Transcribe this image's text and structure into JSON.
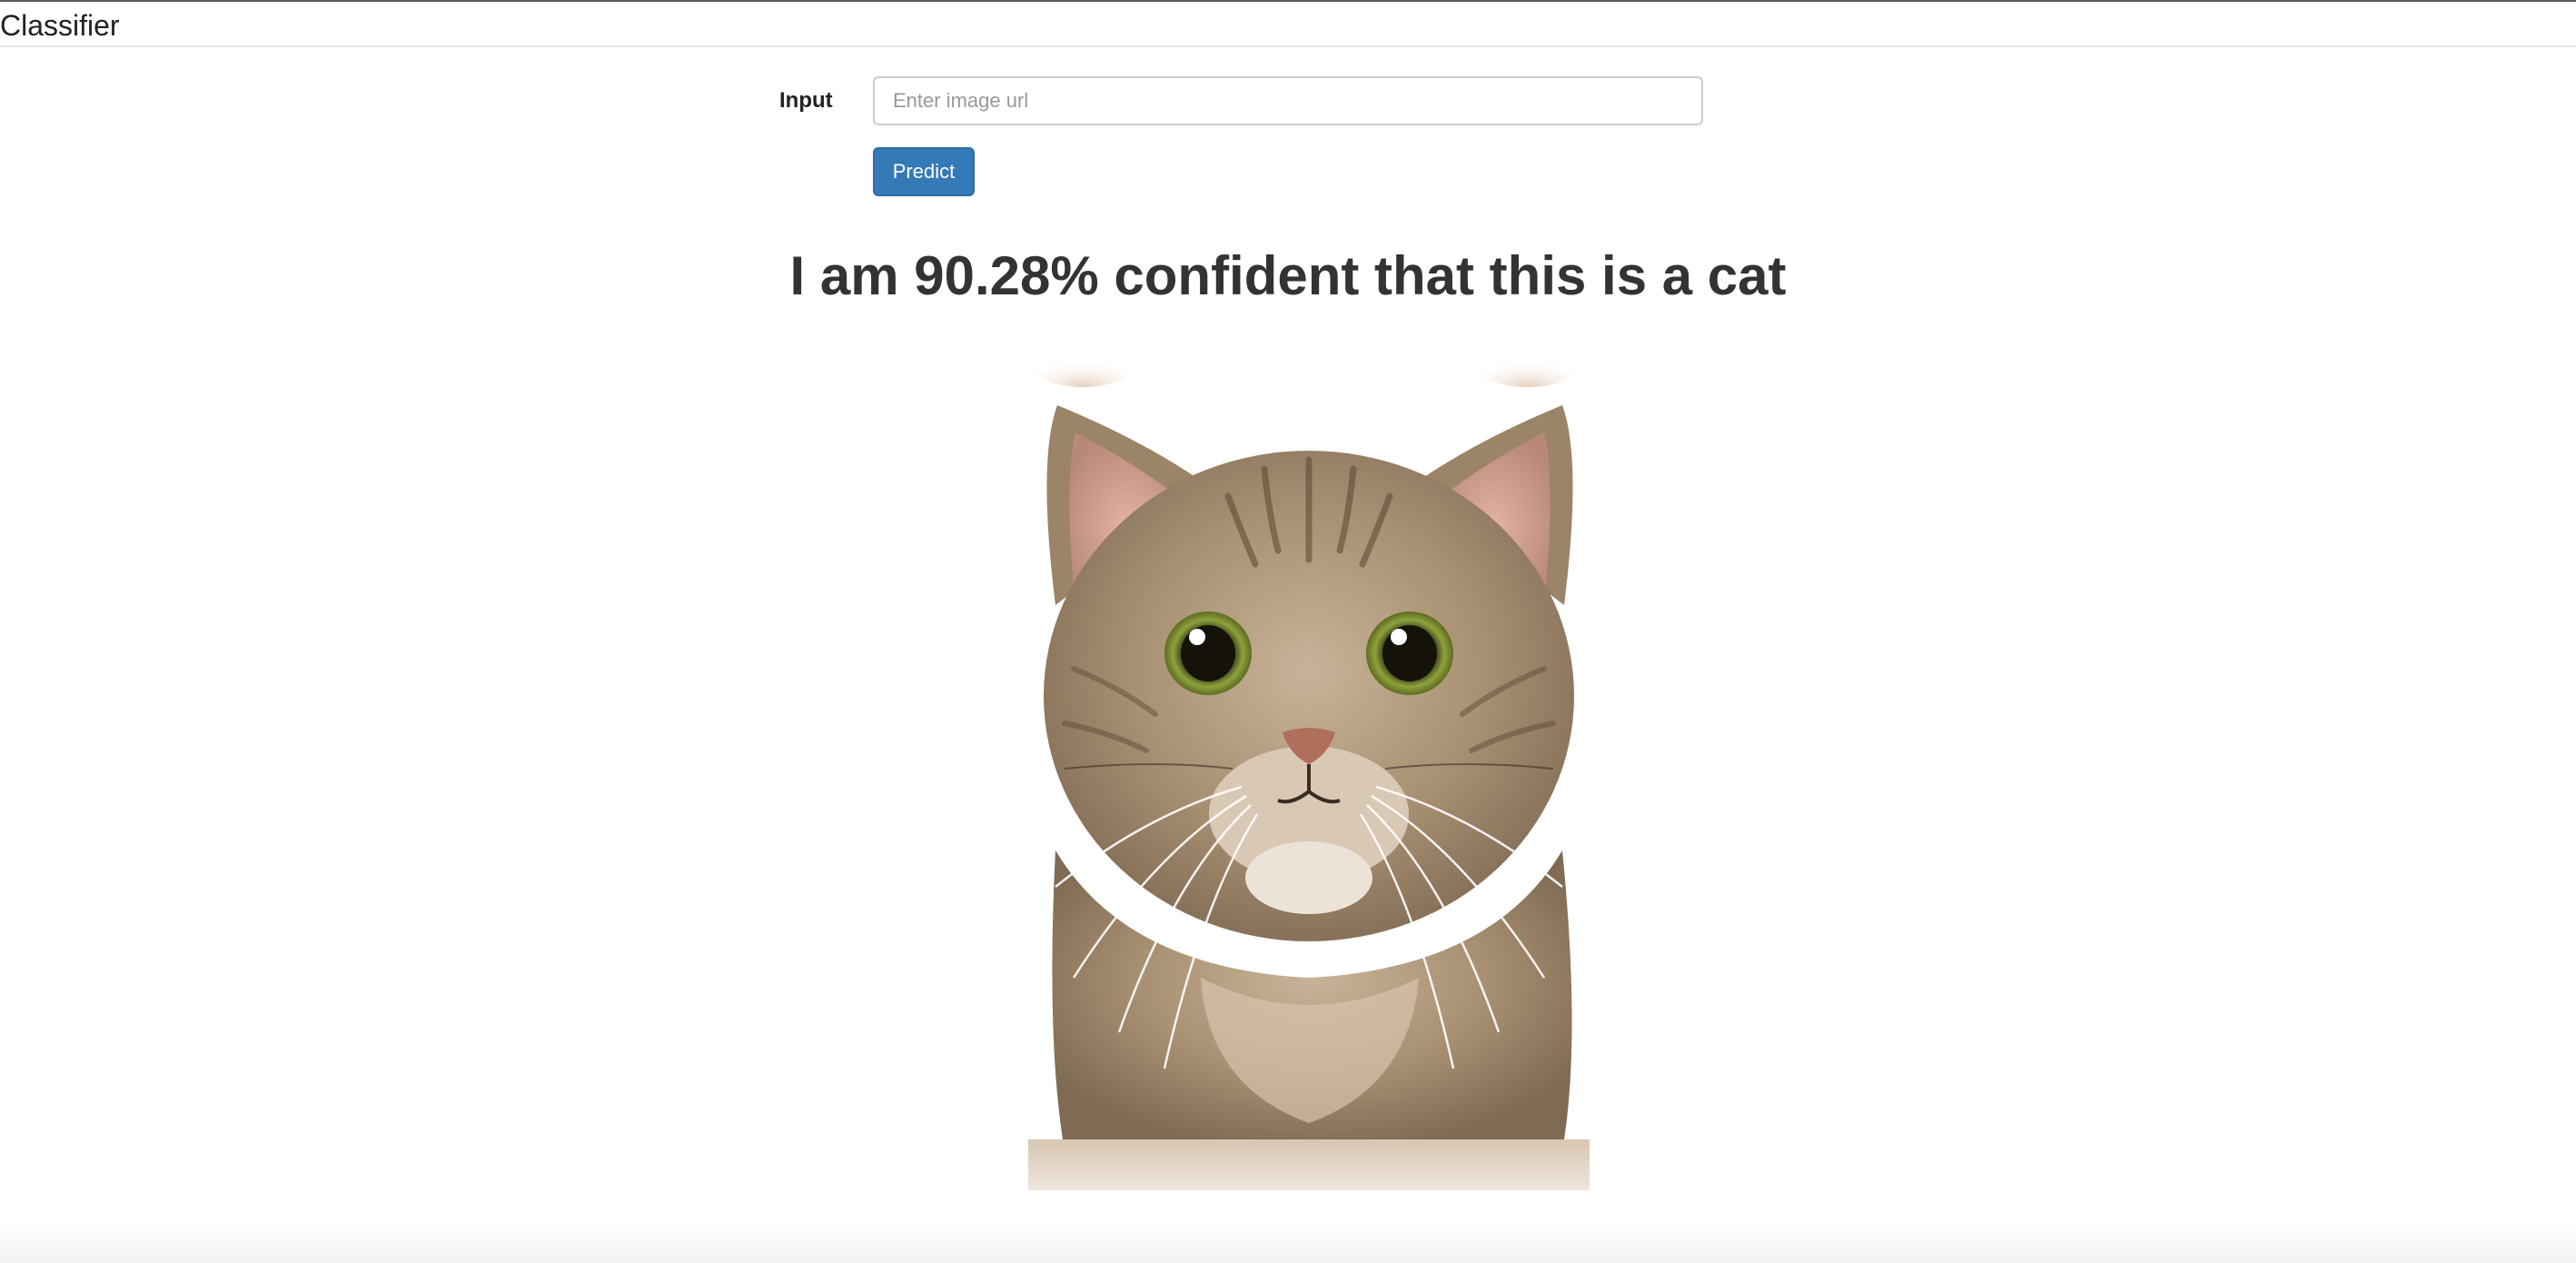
{
  "navbar": {
    "brand": "Classifier"
  },
  "form": {
    "input_label": "Input",
    "input_value": "",
    "input_placeholder": "Enter image url",
    "predict_label": "Predict"
  },
  "result": {
    "heading": "I am 90.28% confident that this is a cat"
  },
  "image": {
    "subject": "cat-photo"
  },
  "colors": {
    "primary_button": "#337ab7",
    "text": "#333333"
  }
}
